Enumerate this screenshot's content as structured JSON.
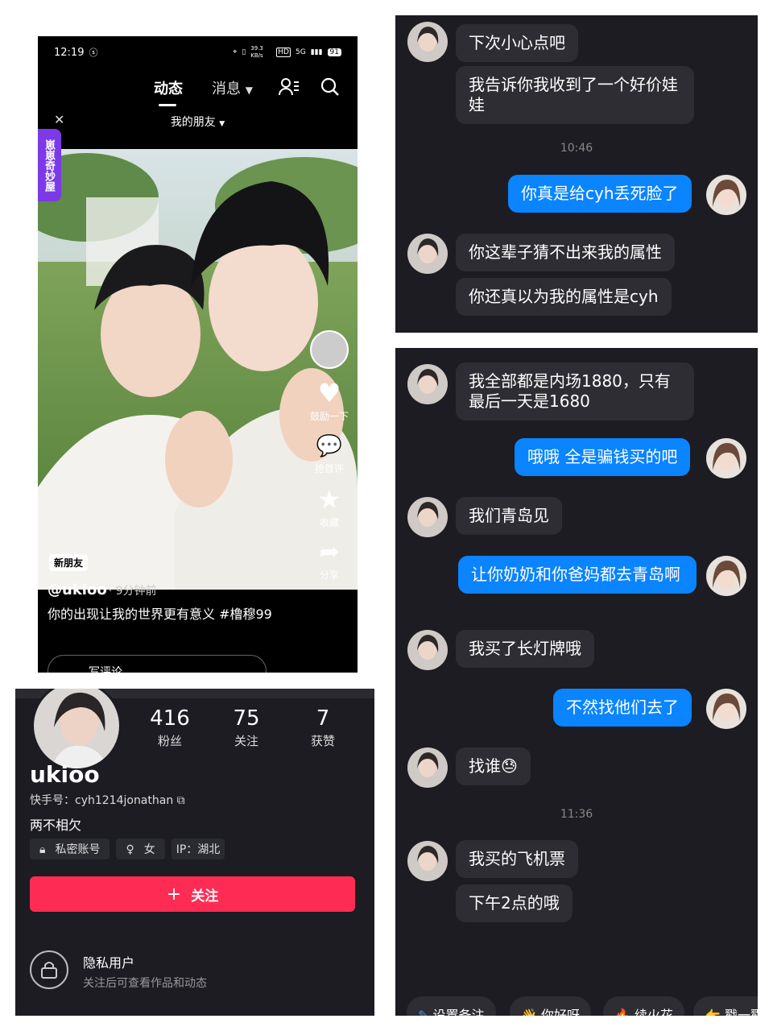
{
  "feed": {
    "status": {
      "time": "12:19",
      "speed": "39.3 KB/s",
      "net": "5G",
      "battery": "91"
    },
    "tabs": [
      {
        "label": "动态"
      },
      {
        "label": "消息"
      }
    ],
    "filter": "我的朋友",
    "side_tag": "崽崽奇妙屋",
    "rail": {
      "like": "鼓励一下",
      "comment": "抢首评",
      "collect": "收藏",
      "share": "分享"
    },
    "new_friend_badge": "新朋友",
    "author": "@ukioo",
    "posted": "· 9分钟前",
    "caption": "你的出现让我的世界更有意义 #橹穆99",
    "comment_placeholder": "写评论",
    "accent": "#7b3ae6"
  },
  "profile": {
    "stats": [
      {
        "num": "416",
        "label": "粉丝"
      },
      {
        "num": "75",
        "label": "关注"
      },
      {
        "num": "7",
        "label": "获赞"
      }
    ],
    "username": "ukioo",
    "kuaishou_id": "快手号：cyh1214jonathan",
    "bio": "两不相欠",
    "tags": [
      "私密账号",
      "女",
      "IP：湖北"
    ],
    "follow_label": "关注",
    "private_title": "隐私用户",
    "private_sub": "关注后可查看作品和动态",
    "follow_color": "#fe2c55"
  },
  "chat_top": {
    "messages": [
      {
        "dir": "in",
        "text": "下次小心点吧"
      },
      {
        "dir": "in",
        "text": "我告诉你我收到了一个好价娃娃"
      },
      {
        "dir": "time",
        "text": "10:46"
      },
      {
        "dir": "out",
        "text": "你真是给cyh丢死脸了"
      },
      {
        "dir": "in",
        "text": "你这辈子猜不出来我的属性"
      },
      {
        "dir": "in",
        "text": "你还真以为我的属性是cyh"
      }
    ]
  },
  "chat_bottom": {
    "messages": [
      {
        "dir": "in",
        "text": "我全部都是内场1880，只有最后一天是1680"
      },
      {
        "dir": "out",
        "text": "哦哦 全是骗钱买的吧"
      },
      {
        "dir": "in",
        "text": "我们青岛见"
      },
      {
        "dir": "out",
        "text": "让你奶奶和你爸妈都去青岛啊"
      },
      {
        "dir": "in",
        "text": "我买了长灯牌哦"
      },
      {
        "dir": "out",
        "text": "不然找他们去了"
      },
      {
        "dir": "in",
        "text": "找谁😓"
      },
      {
        "dir": "time",
        "text": "11:36"
      },
      {
        "dir": "in",
        "text": "我买的飞机票"
      },
      {
        "dir": "in",
        "text": "下午2点的哦"
      }
    ],
    "quick_replies": [
      "设置备注",
      "你好呀",
      "续火花",
      "戳一戳"
    ],
    "out_color": "#0a84ff"
  }
}
